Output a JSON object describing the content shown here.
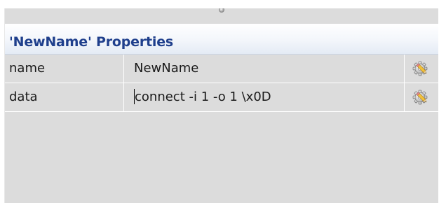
{
  "panel": {
    "title": "'NewName' Properties",
    "properties": [
      {
        "name": "name",
        "value": "NewName",
        "icon": "gear-pencil-icon"
      },
      {
        "name": "data",
        "value": "connect -i 1 -o 1 \\x0D",
        "icon": "gear-pencil-icon"
      }
    ]
  },
  "colors": {
    "title_text": "#1f3f8c",
    "panel_background": "#dcdcdc",
    "title_gradient_top": "#ffffff",
    "title_gradient_bottom": "#e4ebf5"
  }
}
